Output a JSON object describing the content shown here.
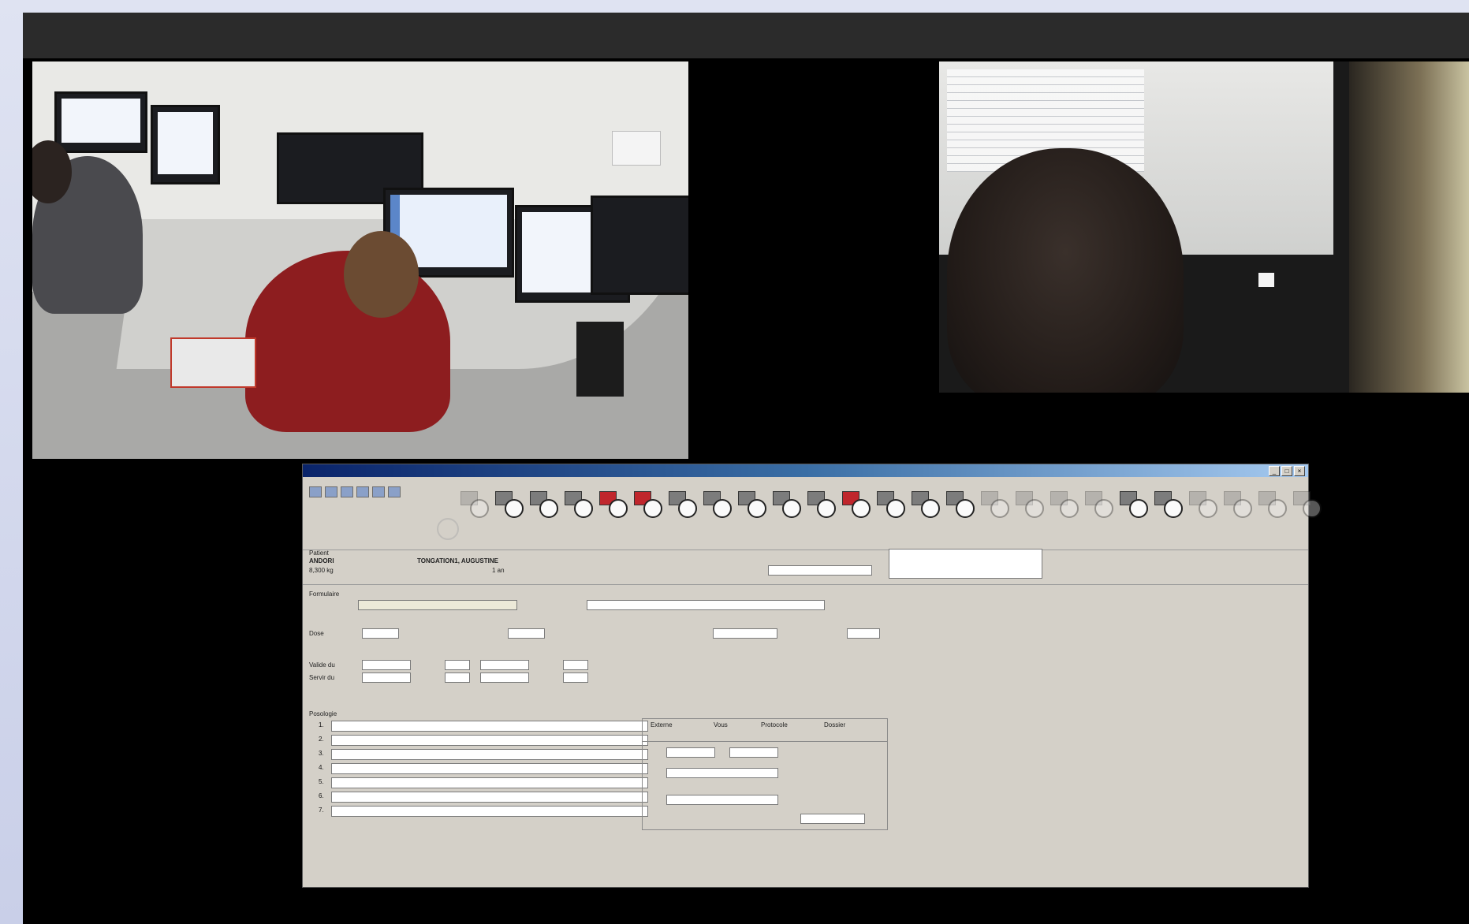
{
  "screen": {
    "top_bar_label": ""
  },
  "videos": {
    "room": {
      "name": "room-overview-video"
    },
    "shoulder": {
      "name": "over-shoulder-video"
    }
  },
  "app": {
    "title": "",
    "patient": {
      "section_label": "Patient",
      "name_short": "ANDORI",
      "full_name": "TONGATION1, AUGUSTINE",
      "age": "1 an",
      "weight": "8,300 kg"
    },
    "form": {
      "labels": {
        "formulation": "Formulaire",
        "dose": "Dose",
        "valid_du": "Valide du",
        "servir_du": "Servir du",
        "posology": "Posologie"
      }
    },
    "posology_rows": [
      {
        "num": "1."
      },
      {
        "num": "2."
      },
      {
        "num": "3."
      },
      {
        "num": "4."
      },
      {
        "num": "5."
      },
      {
        "num": "6."
      },
      {
        "num": "7."
      }
    ],
    "tabs": [
      "Externe",
      "Vous",
      "Protocole",
      "Dossier"
    ],
    "dose_icons": [
      {
        "active": false,
        "red": false
      },
      {
        "active": true,
        "red": false
      },
      {
        "active": true,
        "red": false
      },
      {
        "active": true,
        "red": false
      },
      {
        "active": true,
        "red": true
      },
      {
        "active": true,
        "red": true
      },
      {
        "active": true,
        "red": false
      },
      {
        "active": true,
        "red": false
      },
      {
        "active": true,
        "red": false
      },
      {
        "active": true,
        "red": false
      },
      {
        "active": true,
        "red": false
      },
      {
        "active": true,
        "red": true
      },
      {
        "active": true,
        "red": false
      },
      {
        "active": true,
        "red": false
      },
      {
        "active": true,
        "red": false
      },
      {
        "active": false,
        "red": false
      },
      {
        "active": false,
        "red": false
      },
      {
        "active": false,
        "red": false
      },
      {
        "active": false,
        "red": false
      },
      {
        "active": true,
        "red": false
      },
      {
        "active": true,
        "red": false
      },
      {
        "active": false,
        "red": false
      },
      {
        "active": false,
        "red": false
      },
      {
        "active": false,
        "red": false
      },
      {
        "active": false,
        "red": false
      }
    ]
  }
}
